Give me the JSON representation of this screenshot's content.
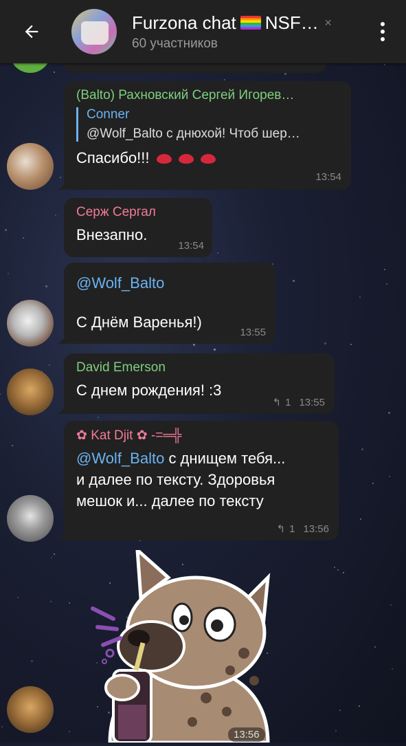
{
  "header": {
    "title": "Furzona chat",
    "title_suffix": "NSF…",
    "subtitle": "60 участников"
  },
  "messages": [
    {
      "sender": "(Balto) Рахновский Сергей Игорев…",
      "sender_color": "#7fcf7f",
      "reply_author": "Conner",
      "reply_text": "@Wolf_Balto с днюхой! Чтоб шер…",
      "text": "Спасибо!!!",
      "time": "13:54"
    },
    {
      "sender": "Серж Сергал",
      "sender_color": "#f27b9a",
      "text": "Внезапно.",
      "time": "13:54"
    },
    {
      "mention": "@Wolf_Balto",
      "text": "С Днём Варенья!)",
      "time": "13:55"
    },
    {
      "sender": "David Emerson",
      "sender_color": "#7fcf7f",
      "text": "С днем рождения! :3",
      "replies": "1",
      "time": "13:55"
    },
    {
      "sender": "Kat Djit",
      "sender_suffix": "-=═╬",
      "sender_color": "#f27b9a",
      "mention": "@Wolf_Balto",
      "text_after_mention": " с днищем тебя...",
      "text_line2": "и далее по тексту. Здоровья",
      "text_line3": "мешок и... далее по тексту",
      "replies": "1",
      "time": "13:56"
    }
  ],
  "sticker": {
    "time": "13:56"
  }
}
